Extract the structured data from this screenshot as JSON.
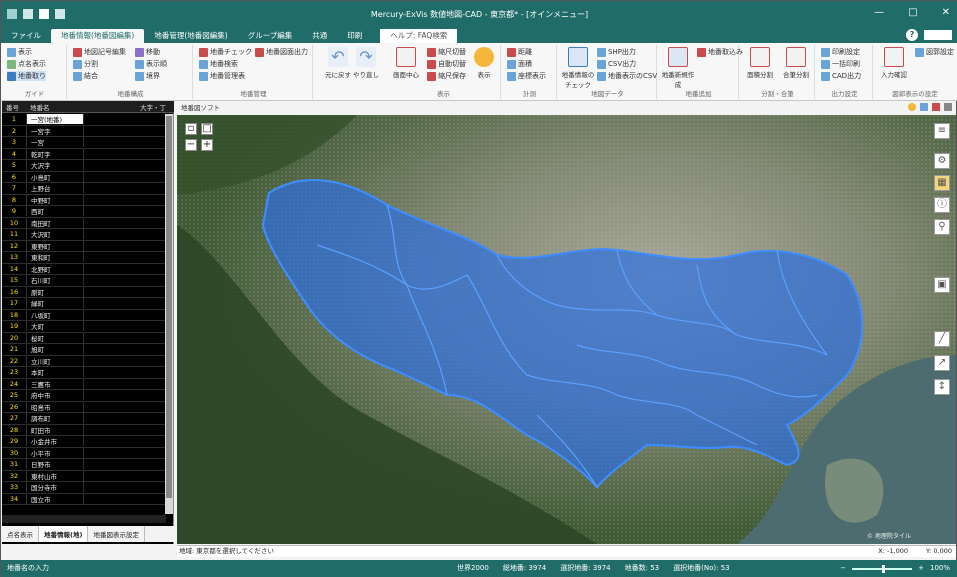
{
  "window": {
    "title": "Mercury-ExVis 数値地図-CAD - 東京都* - [オインメニュー]",
    "controls": [
      "—",
      "□",
      "✕"
    ]
  },
  "tabs": [
    {
      "label": "ファイル",
      "active": false
    },
    {
      "label": "地番情報(地番図編集)",
      "active": true
    },
    {
      "label": "地番管理(地番図編集)",
      "active": false
    },
    {
      "label": "グループ編集",
      "active": false
    },
    {
      "label": "共通",
      "active": false
    },
    {
      "label": "印刷",
      "active": false
    }
  ],
  "search": {
    "placeholder": "ヘルプ: FAQ検索"
  },
  "ribbon": {
    "group1": {
      "label": "ガイド",
      "items": [
        "表示",
        "点名表示",
        "地番取り"
      ]
    },
    "group2": {
      "label": "地番構成",
      "items": [
        "地図記号編集",
        "分割",
        "結合",
        "移動",
        "表示順",
        "境界"
      ]
    },
    "group3": {
      "label": "地番管理",
      "items": [
        "地番チェック",
        "地番図面出力",
        "地番検索",
        "地番管理表"
      ]
    },
    "undo": {
      "label": "元に戻す"
    },
    "redo": {
      "label": "やり直し"
    },
    "group4": {
      "label": "表示",
      "items": [
        "画面中心",
        "縮尺切替",
        "自動切替",
        "縮尺保存",
        "表示"
      ]
    },
    "group5": {
      "label": "計測",
      "items": [
        "距離",
        "面積",
        "座標表示"
      ]
    },
    "group6": {
      "label": "地図データ",
      "items": [
        "地番情報のチェック",
        "SHP出力",
        "CSV出力",
        "地番表示のCSV"
      ]
    },
    "group7": {
      "label": "地番追加",
      "items": [
        "地番新規作成",
        "地番取込み"
      ]
    },
    "group8": {
      "label": "分割・合筆",
      "items": [
        "面積分割",
        "合筆分割"
      ]
    },
    "group9": {
      "label": "出力設定",
      "items": [
        "印刷設定",
        "一括印刷",
        "CAD出力"
      ]
    },
    "group10": {
      "label": "図郭表示の設定",
      "items": [
        "入力確認",
        "図郭設定"
      ]
    }
  },
  "left_panel": {
    "headers": [
      "番号",
      "地番名",
      "大字・丁"
    ],
    "rows": [
      {
        "n": "1",
        "name": "一宮(地番)",
        "sel": true
      },
      {
        "n": "2",
        "name": "一宮字",
        "sel": false
      },
      {
        "n": "3",
        "name": "一宮",
        "sel": false
      },
      {
        "n": "4",
        "name": "乾町字",
        "sel": false
      },
      {
        "n": "5",
        "name": "大沢字",
        "sel": false
      },
      {
        "n": "6",
        "name": "小島町",
        "sel": false
      },
      {
        "n": "7",
        "name": "上野台",
        "sel": false
      },
      {
        "n": "8",
        "name": "中野町",
        "sel": false
      },
      {
        "n": "9",
        "name": "西町",
        "sel": false
      },
      {
        "n": "10",
        "name": "南田町",
        "sel": false
      },
      {
        "n": "11",
        "name": "大沢町",
        "sel": false
      },
      {
        "n": "12",
        "name": "東野町",
        "sel": false
      },
      {
        "n": "13",
        "name": "東和町",
        "sel": false
      },
      {
        "n": "14",
        "name": "北野町",
        "sel": false
      },
      {
        "n": "15",
        "name": "石川町",
        "sel": false
      },
      {
        "n": "16",
        "name": "原町",
        "sel": false
      },
      {
        "n": "17",
        "name": "緑町",
        "sel": false
      },
      {
        "n": "18",
        "name": "八坂町",
        "sel": false
      },
      {
        "n": "19",
        "name": "大町",
        "sel": false
      },
      {
        "n": "20",
        "name": "桜町",
        "sel": false
      },
      {
        "n": "21",
        "name": "旭町",
        "sel": false
      },
      {
        "n": "22",
        "name": "立川町",
        "sel": false
      },
      {
        "n": "23",
        "name": "本町",
        "sel": false
      },
      {
        "n": "24",
        "name": "三鷹市",
        "sel": false
      },
      {
        "n": "25",
        "name": "府中市",
        "sel": false
      },
      {
        "n": "26",
        "name": "昭島市",
        "sel": false
      },
      {
        "n": "27",
        "name": "調布町",
        "sel": false
      },
      {
        "n": "28",
        "name": "町田市",
        "sel": false
      },
      {
        "n": "29",
        "name": "小金井市",
        "sel": false
      },
      {
        "n": "30",
        "name": "小平市",
        "sel": false
      },
      {
        "n": "31",
        "name": "日野市",
        "sel": false
      },
      {
        "n": "32",
        "name": "東村山市",
        "sel": false
      },
      {
        "n": "33",
        "name": "国分寺市",
        "sel": false
      },
      {
        "n": "34",
        "name": "国立市",
        "sel": false
      }
    ],
    "tabs": [
      "点名表示",
      "地番情報(地)",
      "地番図表示設定"
    ]
  },
  "map": {
    "toolbar_label": "地番図ソフト",
    "zoom_in": "+",
    "zoom_out": "−",
    "overlay_color": "#3a7fe0",
    "copyright": "© 地理院タイル"
  },
  "cmdbar": {
    "text": "地域: 東京都を選択してください",
    "x_label": "X:",
    "x_value": "-1,000",
    "y_label": "Y:",
    "y_value": "0.000"
  },
  "status": {
    "left": "地番名の入力",
    "items": [
      "世界2000",
      "総地番: 3974",
      "選択地番: 3974",
      "地番数: 53",
      "選択地番(No): 53"
    ],
    "zoom": "100%"
  }
}
